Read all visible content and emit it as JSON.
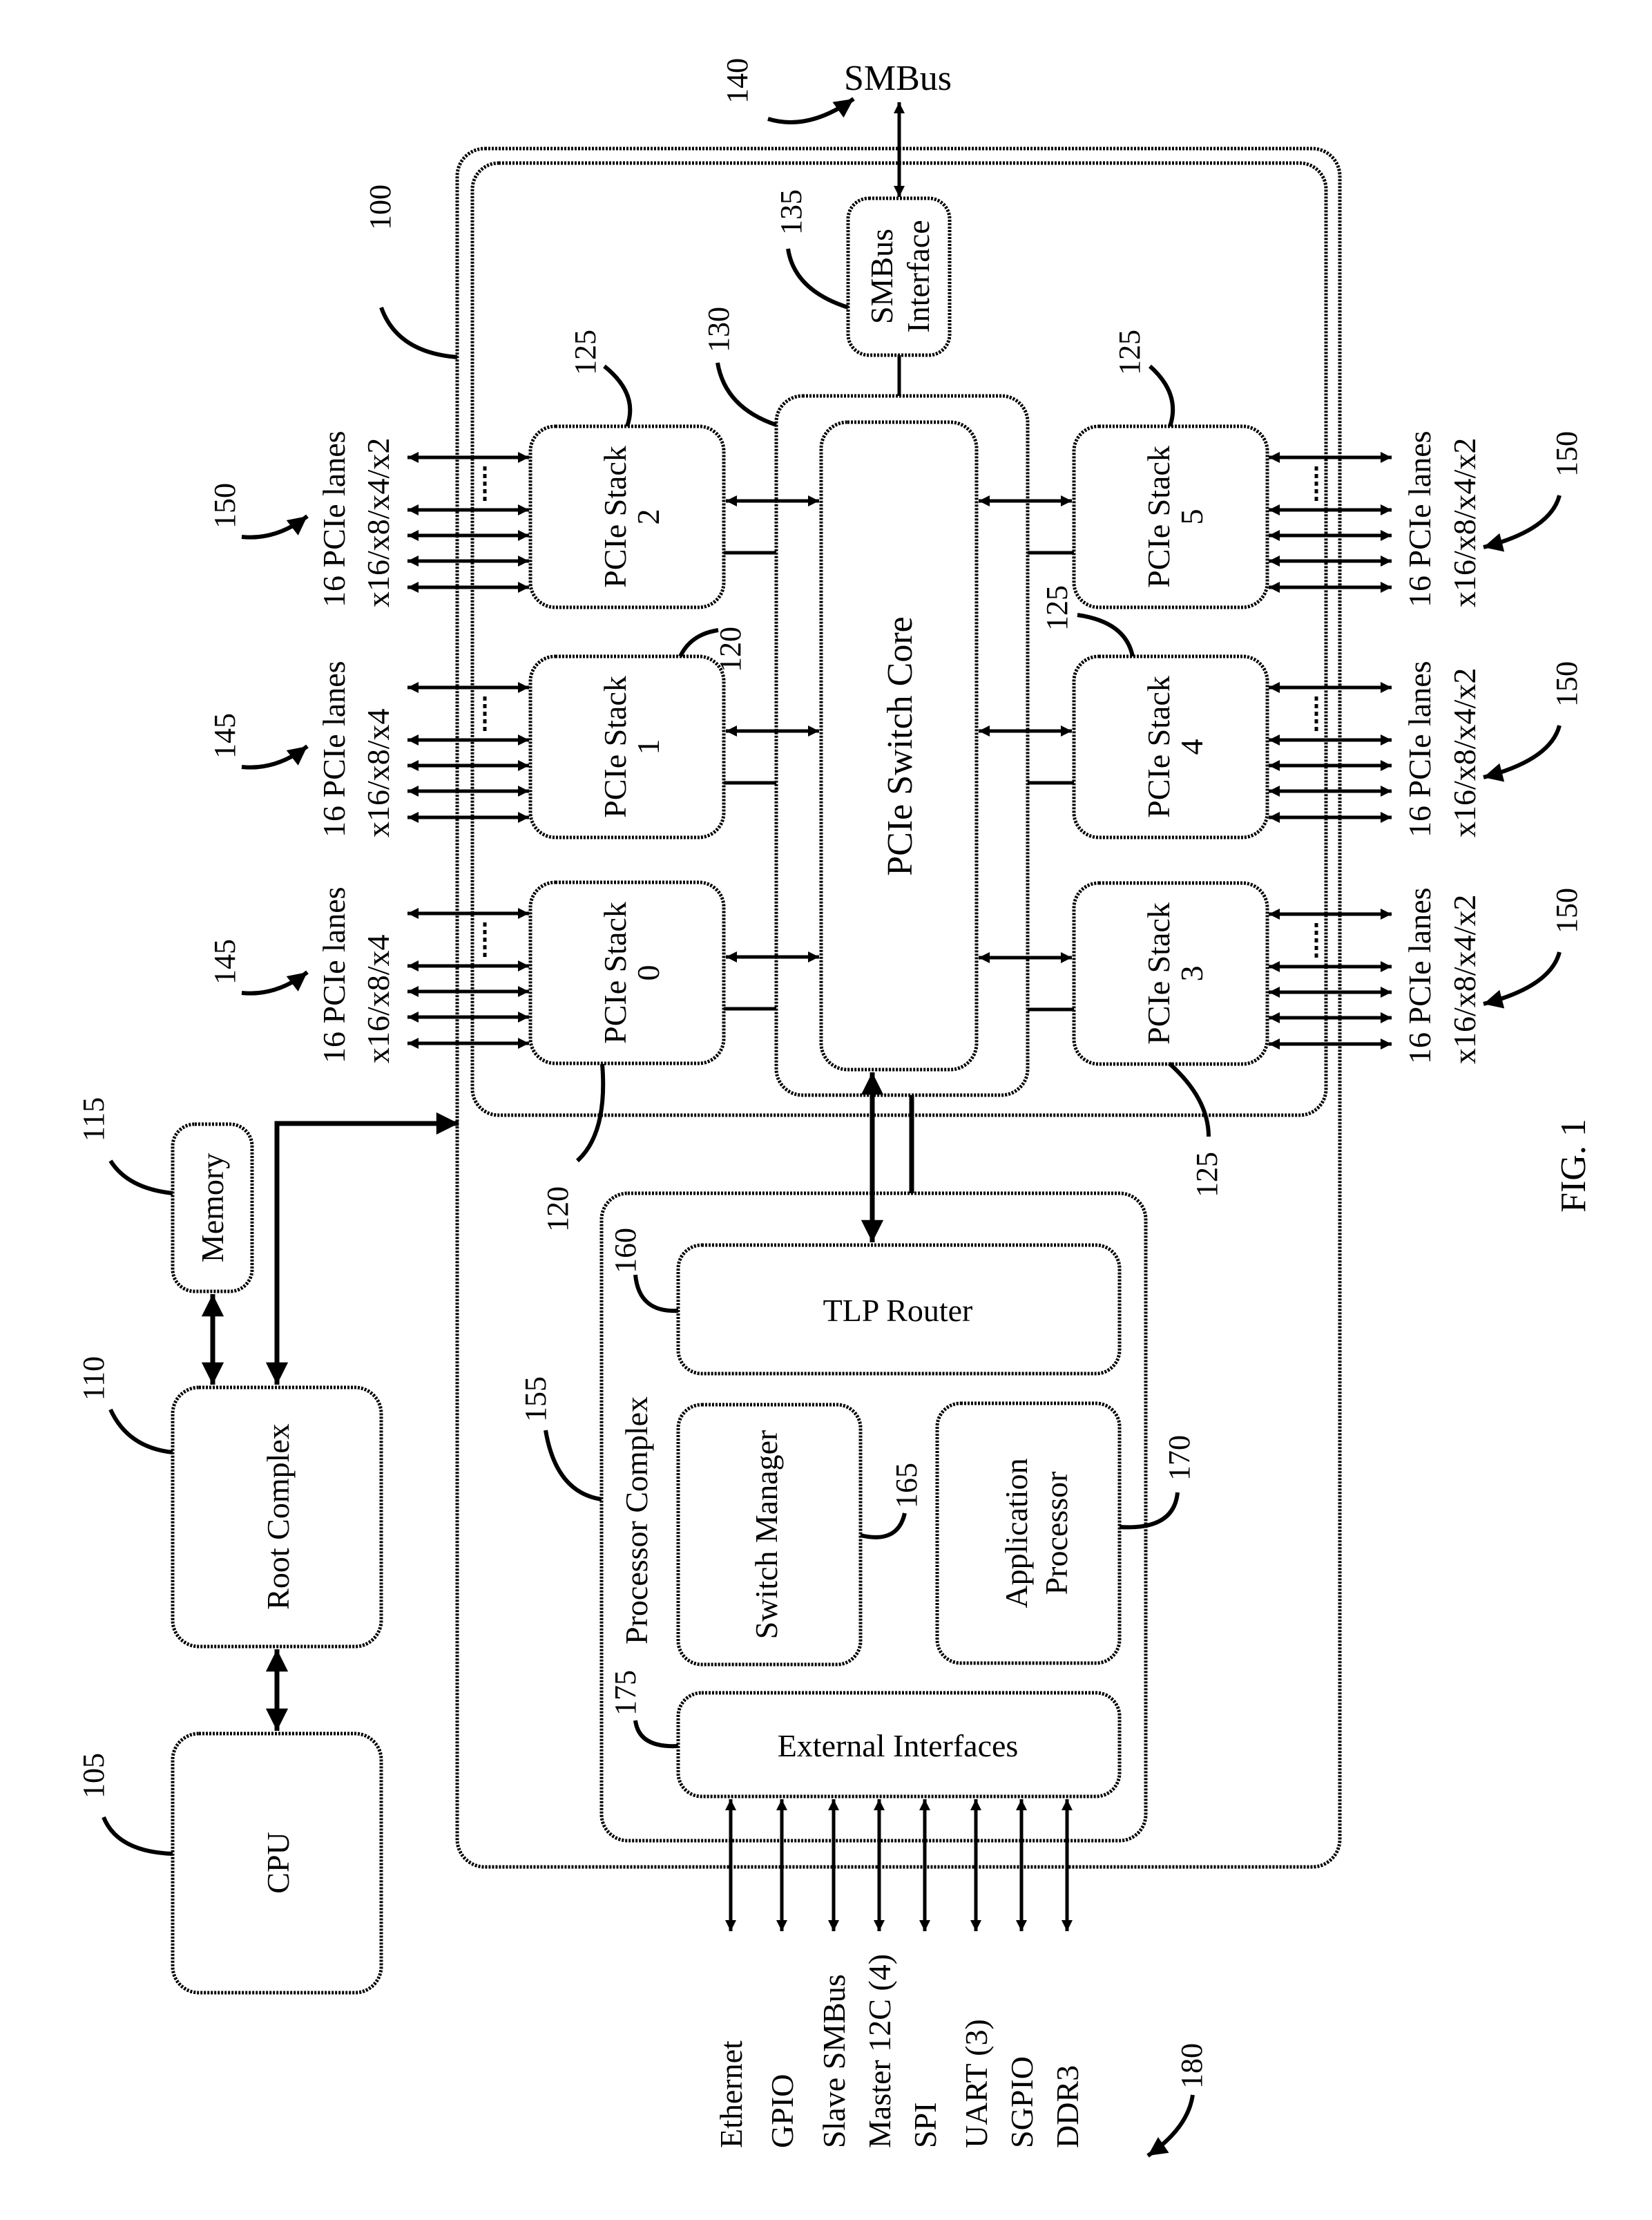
{
  "figure": {
    "caption": "FIG. 1",
    "colors": {
      "ink": "#000000",
      "paper": "#ffffff"
    }
  },
  "external": {
    "smbus": {
      "label": "SMBus",
      "ref": "140"
    },
    "cpu": {
      "label": "CPU",
      "ref": "105"
    },
    "root_complex": {
      "label": "Root Complex",
      "ref": "110"
    },
    "memory": {
      "label": "Memory",
      "ref": "115"
    }
  },
  "switch": {
    "ref": "100",
    "smbus_interface": {
      "label_line1": "SMBus",
      "label_line2": "Interface",
      "ref": "135"
    },
    "core": {
      "label": "PCIe Switch Core",
      "ref": "130"
    },
    "stacks": [
      {
        "label": "PCIe Stack",
        "index": "0",
        "ref": "120",
        "lanes_label": "16 PCIe lanes",
        "widths_label": "x16/x8/x4",
        "lanes_ref": "145"
      },
      {
        "label": "PCIe Stack",
        "index": "1",
        "ref": "120",
        "lanes_label": "16 PCIe lanes",
        "widths_label": "x16/x8/x4",
        "lanes_ref": "145"
      },
      {
        "label": "PCIe Stack",
        "index": "2",
        "ref": "125",
        "lanes_label": "16 PCIe lanes",
        "widths_label": "x16/x8/x4/x2",
        "lanes_ref": "150"
      },
      {
        "label": "PCIe Stack",
        "index": "3",
        "ref": "125",
        "lanes_label": "16 PCIe lanes",
        "widths_label": "x16/x8/x4/x2",
        "lanes_ref": "150"
      },
      {
        "label": "PCIe Stack",
        "index": "4",
        "ref": "125",
        "lanes_label": "16 PCIe lanes",
        "widths_label": "x16/x8/x4/x2",
        "lanes_ref": "150"
      },
      {
        "label": "PCIe Stack",
        "index": "5",
        "ref": "125",
        "lanes_label": "16 PCIe lanes",
        "widths_label": "x16/x8/x4/x2",
        "lanes_ref": "150"
      }
    ],
    "processor_complex": {
      "label": "Processor Complex",
      "ref": "155",
      "tlp_router": {
        "label": "TLP Router",
        "ref": "160"
      },
      "switch_manager": {
        "label": "Switch Manager",
        "ref": "165"
      },
      "application_processor": {
        "label_line1": "Application",
        "label_line2": "Processor",
        "ref": "170"
      },
      "external_interfaces": {
        "label": "External Interfaces",
        "ref": "175"
      }
    }
  },
  "interfaces": {
    "ref": "180",
    "items": [
      "Ethernet",
      "GPIO",
      "Slave SMBus",
      "Master 12C (4)",
      "SPI",
      "UART (3)",
      "SGPIO",
      "DDR3"
    ]
  }
}
